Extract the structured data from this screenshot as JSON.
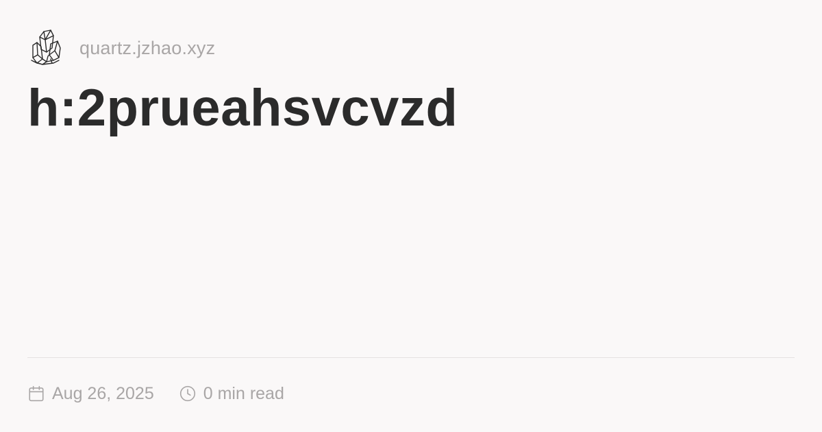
{
  "header": {
    "logo_icon": "crystal-logo-icon",
    "domain": "quartz.jzhao.xyz"
  },
  "page": {
    "title": "h:2prueahsvcvzd"
  },
  "meta": {
    "date_icon": "calendar-icon",
    "date": "Aug 26, 2025",
    "reading_time_icon": "clock-icon",
    "reading_time": "0 min read"
  },
  "colors": {
    "background": "#faf8f8",
    "title": "#2b2b2b",
    "muted": "#a9a6a6",
    "divider": "#e5e2e2"
  }
}
